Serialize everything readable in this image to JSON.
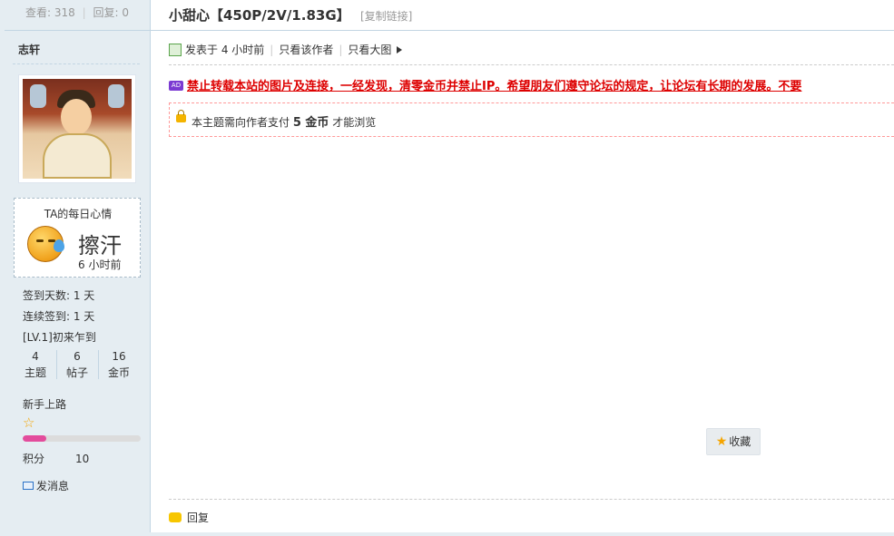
{
  "sidebar_top": {
    "views_label": "查看:",
    "views": "318",
    "replies_label": "回复:",
    "replies": "0"
  },
  "author": {
    "name": "志轩",
    "mood": {
      "title": "TA的每日心情",
      "text": "擦汗",
      "time": "6 小时前",
      "icon": "sweat-face-icon"
    },
    "signin_days": "签到天数: 1 天",
    "streak_days": "连续签到: 1 天",
    "level": "[LV.1]初来乍到",
    "counts": [
      {
        "value": "4",
        "label": "主题"
      },
      {
        "value": "6",
        "label": "帖子"
      },
      {
        "value": "16",
        "label": "金币"
      }
    ],
    "rank": "新手上路",
    "progress": 0.2,
    "score_label": "积分",
    "score_value": "10",
    "message_label": "发消息"
  },
  "thread": {
    "title": "小甜心【450P/2V/1.83G】",
    "copy_link": "[复制链接]",
    "posted": "发表于 4 小时前",
    "only_author": "只看该作者",
    "only_images": "只看大图",
    "ad_text": "禁止转载本站的图片及连接，一经发现，清零金币并禁止IP。希望朋友们遵守论坛的规定，让论坛有长期的发展。不要",
    "locked_pre": "本主题需向作者支付",
    "locked_price": "5 金币",
    "locked_post": "才能浏览",
    "favorite": "收藏",
    "reply": "回复"
  },
  "colors": {
    "sidebar_bg": "#e5edf2",
    "accent_red": "#dd0000",
    "progress_pink": "#e34c9c"
  }
}
